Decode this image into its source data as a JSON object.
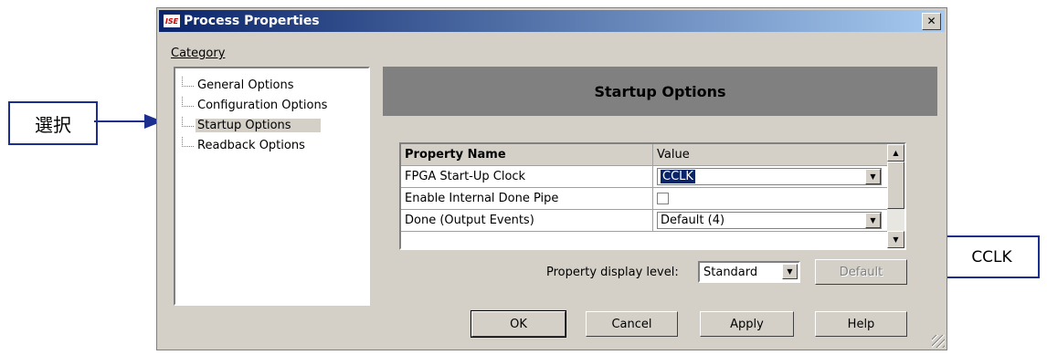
{
  "annotations": {
    "left_callout": "選択",
    "right_callout": "CCLK"
  },
  "dialog": {
    "title": "Process Properties",
    "app_icon_text": "ISE",
    "close_glyph": "✕",
    "category_label": "Category",
    "tree_items": [
      {
        "label": "General Options",
        "selected": false
      },
      {
        "label": "Configuration Options",
        "selected": false
      },
      {
        "label": "Startup Options",
        "selected": true
      },
      {
        "label": "Readback Options",
        "selected": false
      }
    ],
    "panel_title": "Startup Options",
    "grid": {
      "headers": {
        "name": "Property Name",
        "value": "Value"
      },
      "rows": [
        {
          "name": "FPGA Start-Up Clock",
          "type": "combo",
          "value": "CCLK",
          "selected": true
        },
        {
          "name": "Enable Internal Done Pipe",
          "type": "checkbox",
          "checked": false
        },
        {
          "name": "Done (Output Events)",
          "type": "combo",
          "value": "Default (4)",
          "selected": false
        }
      ]
    },
    "display_level_label": "Property display level:",
    "display_level_value": "Standard",
    "buttons": {
      "default": "Default",
      "ok": "OK",
      "cancel": "Cancel",
      "apply": "Apply",
      "help": "Help"
    },
    "icons": {
      "dropdown": "▼",
      "scroll_up": "▲",
      "scroll_down": "▼"
    },
    "colors": {
      "title_start": "#0a246a",
      "title_end": "#a6caf0",
      "selection": "#0a246a",
      "face": "#d4d0c8",
      "callout_border": "#1c2f8f"
    }
  }
}
